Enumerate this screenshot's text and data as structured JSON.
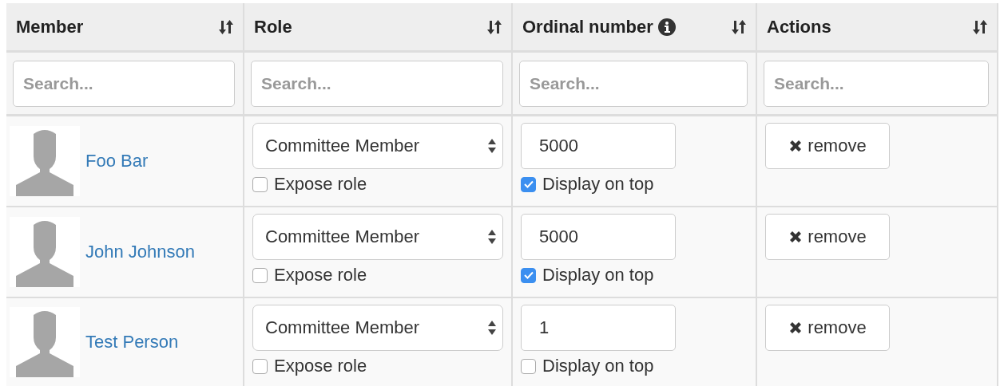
{
  "table": {
    "columns": [
      {
        "label": "Member",
        "info": false
      },
      {
        "label": "Role",
        "info": false
      },
      {
        "label": "Ordinal number",
        "info": true
      },
      {
        "label": "Actions",
        "info": false
      }
    ],
    "filters": [
      {
        "placeholder": "Search..."
      },
      {
        "placeholder": "Search..."
      },
      {
        "placeholder": "Search..."
      },
      {
        "placeholder": "Search..."
      }
    ],
    "rows": [
      {
        "member": "Foo Bar",
        "role": "Committee Member",
        "expose_role": {
          "label": "Expose role",
          "checked": false
        },
        "ordinal": "5000",
        "display_on_top": {
          "label": "Display on top",
          "checked": true
        },
        "action": "remove"
      },
      {
        "member": "John Johnson",
        "role": "Committee Member",
        "expose_role": {
          "label": "Expose role",
          "checked": false
        },
        "ordinal": "5000",
        "display_on_top": {
          "label": "Display on top",
          "checked": true
        },
        "action": "remove"
      },
      {
        "member": "Test Person",
        "role": "Committee Member",
        "expose_role": {
          "label": "Expose role",
          "checked": false
        },
        "ordinal": "1",
        "display_on_top": {
          "label": "Display on top",
          "checked": false
        },
        "action": "remove"
      }
    ]
  }
}
